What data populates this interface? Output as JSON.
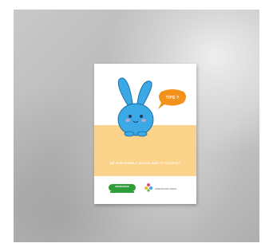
{
  "scene": {
    "wall_color": "#bdbdbd",
    "poster_color": "#ffffff",
    "accent_yellow": "#fbd38a",
    "bunny_color": "#3aa9e6",
    "bubble_color": "#f2921c"
  },
  "poster": {
    "bubble_text": "TIPS ?",
    "headline": "SE HUR ENKELT KLAAS HAR TV STARTAT",
    "logo_left_label": "SPARBANKEN",
    "logo_right_label": "FÖRVÄNTAT BARN"
  }
}
